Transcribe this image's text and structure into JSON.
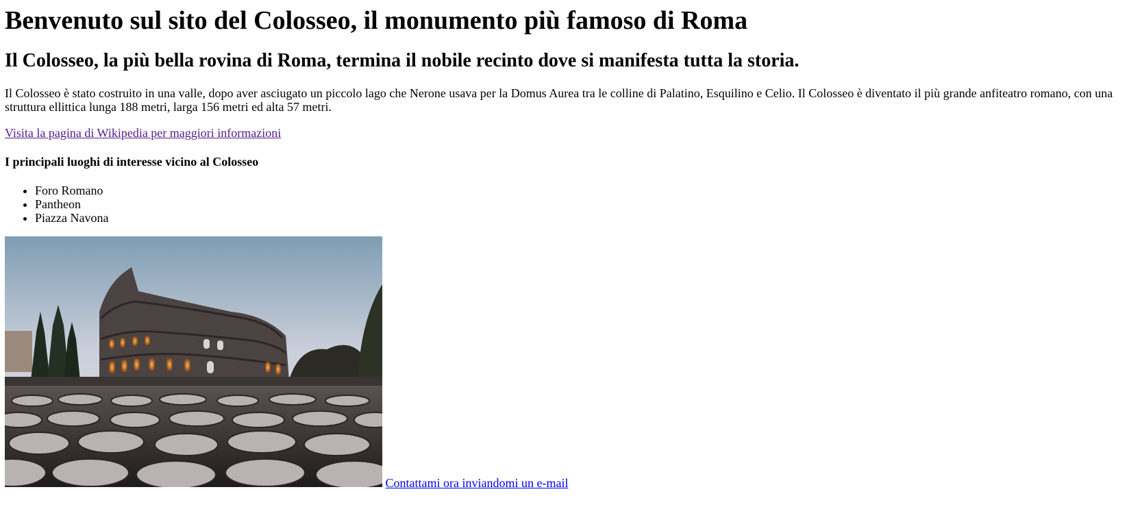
{
  "page": {
    "heading": "Benvenuto sul sito del Colosseo, il monumento più famoso di Roma",
    "subheading": "Il Colosseo, la più bella rovina di Roma, termina il nobile recinto dove si manifesta tutta la storia.",
    "intro": "Il Colosseo è stato costruito in una valle, dopo aver asciugato un piccolo lago che Nerone usava per la Domus Aurea tra le colline di Palatino, Esquilino e Celio. Il Colosseo è diventato il più grande anfiteatro romano, con una struttura ellittica lunga 188 metri, larga 156 metri ed alta 57 metri.",
    "wiki_link": "Visita la pagina di Wikipedia per maggiori informazioni",
    "places_title": "I principali luoghi di interesse vicino al Colosseo",
    "places": [
      "Foro Romano",
      "Pantheon",
      "Piazza Navona"
    ],
    "contact_link": "Contattami ora inviandomi un e-mail"
  },
  "colors": {
    "visited_link": "#551a8b",
    "link": "#0000ee"
  }
}
